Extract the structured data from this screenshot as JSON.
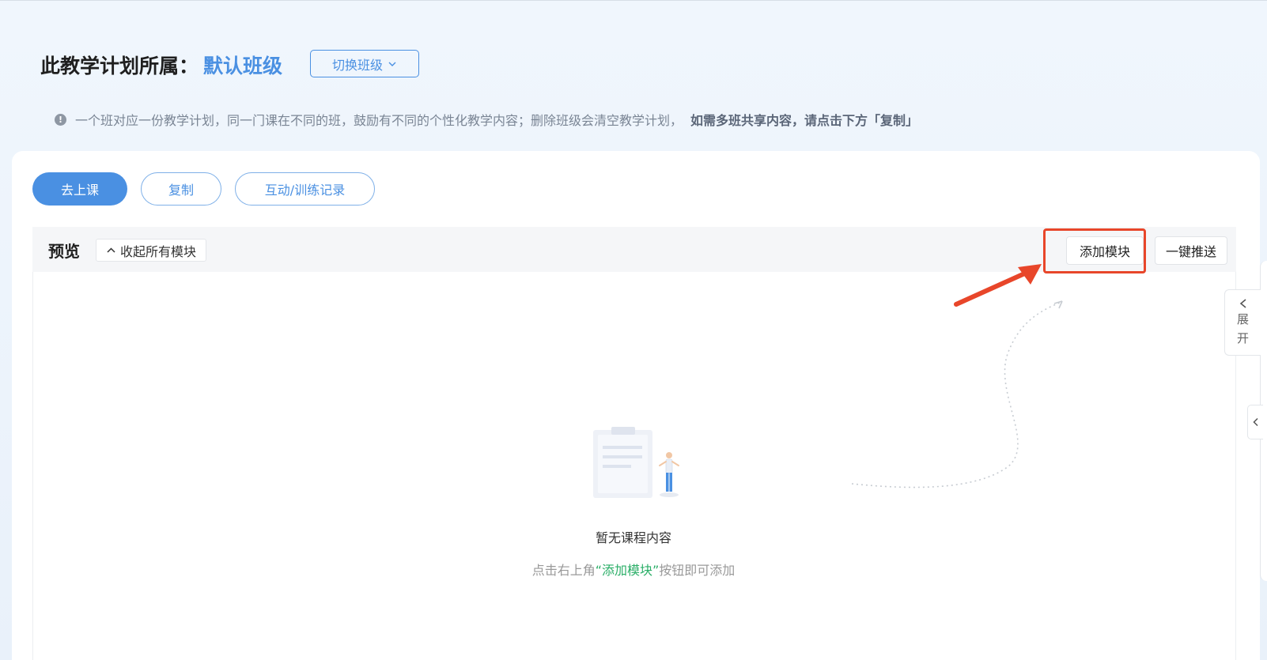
{
  "header": {
    "title_prefix": "此教学计划所属：",
    "class_name": "默认班级",
    "switch_button": "切换班级"
  },
  "notice": {
    "text": "一个班对应一份教学计划，同一门课在不同的班，鼓励有不同的个性化教学内容；删除班级会清空教学计划，",
    "emphasis": "如需多班共享内容，请点击下方「复制」"
  },
  "actions": {
    "go_class": "去上课",
    "copy": "复制",
    "records": "互动/训练记录"
  },
  "preview": {
    "label": "预览",
    "collapse_all": "收起所有模块",
    "add_module": "添加模块",
    "push_all": "一键推送"
  },
  "empty_state": {
    "title": "暂无课程内容",
    "hint_before": "点击右上角",
    "hint_highlight": "“添加模块”",
    "hint_after": "按钮即可添加"
  },
  "side_panel": {
    "expand_top": "展",
    "expand_bottom": "开"
  },
  "colors": {
    "accent": "#4a90e2",
    "annotation": "#e8462a",
    "success": "#2aae67"
  }
}
